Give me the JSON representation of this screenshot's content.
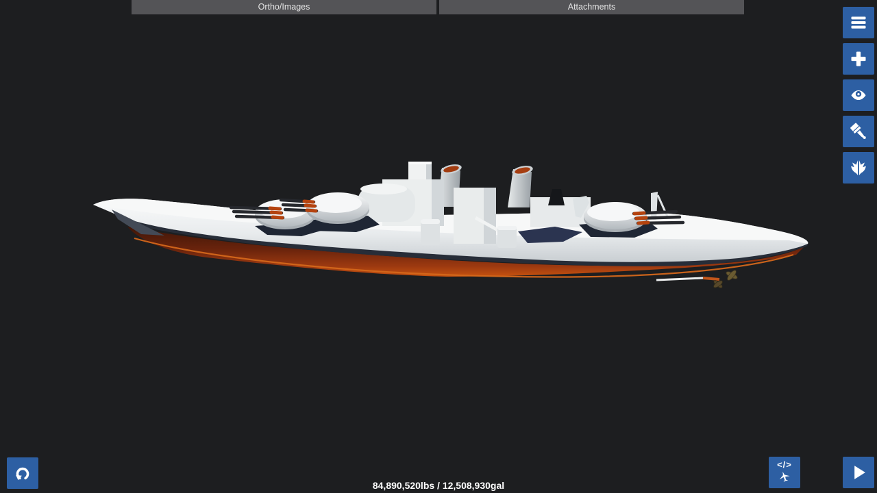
{
  "top_tabs": {
    "items": [
      {
        "label": "Ortho/Images"
      },
      {
        "label": "Attachments"
      }
    ]
  },
  "right_toolbar": {
    "buttons": [
      {
        "icon": "menu-icon"
      },
      {
        "icon": "add-part-icon"
      },
      {
        "icon": "visibility-eye-icon"
      },
      {
        "icon": "paint-brush-icon"
      },
      {
        "icon": "mirror-aircraft-icon"
      }
    ]
  },
  "corner_buttons": {
    "undo_icon": "undo-arrow-icon",
    "xml_editor_label": "</>",
    "xml_editor_icon": "airplane-icon",
    "play_icon": "play-icon"
  },
  "bottom_bar": {
    "weight_fuel": "84,890,520lbs / 12,508,930gal"
  },
  "colors": {
    "background": "#1d1e20",
    "accent_blue": "#2d5fa3",
    "tab_gray": "#545457",
    "hull_white": "#ebeeee",
    "hull_lower_red": "#8a2f10",
    "hull_waterline_navy": "#272d38",
    "funnel_top_orange": "#a23c10"
  },
  "ship": {
    "description": "White battleship model in side view: red-orange lower hull, dark waterline band, two forward triple-gun turrets, one aft triple-gun turret, two raked funnels with orange tops, black stack, propellers at stern"
  }
}
